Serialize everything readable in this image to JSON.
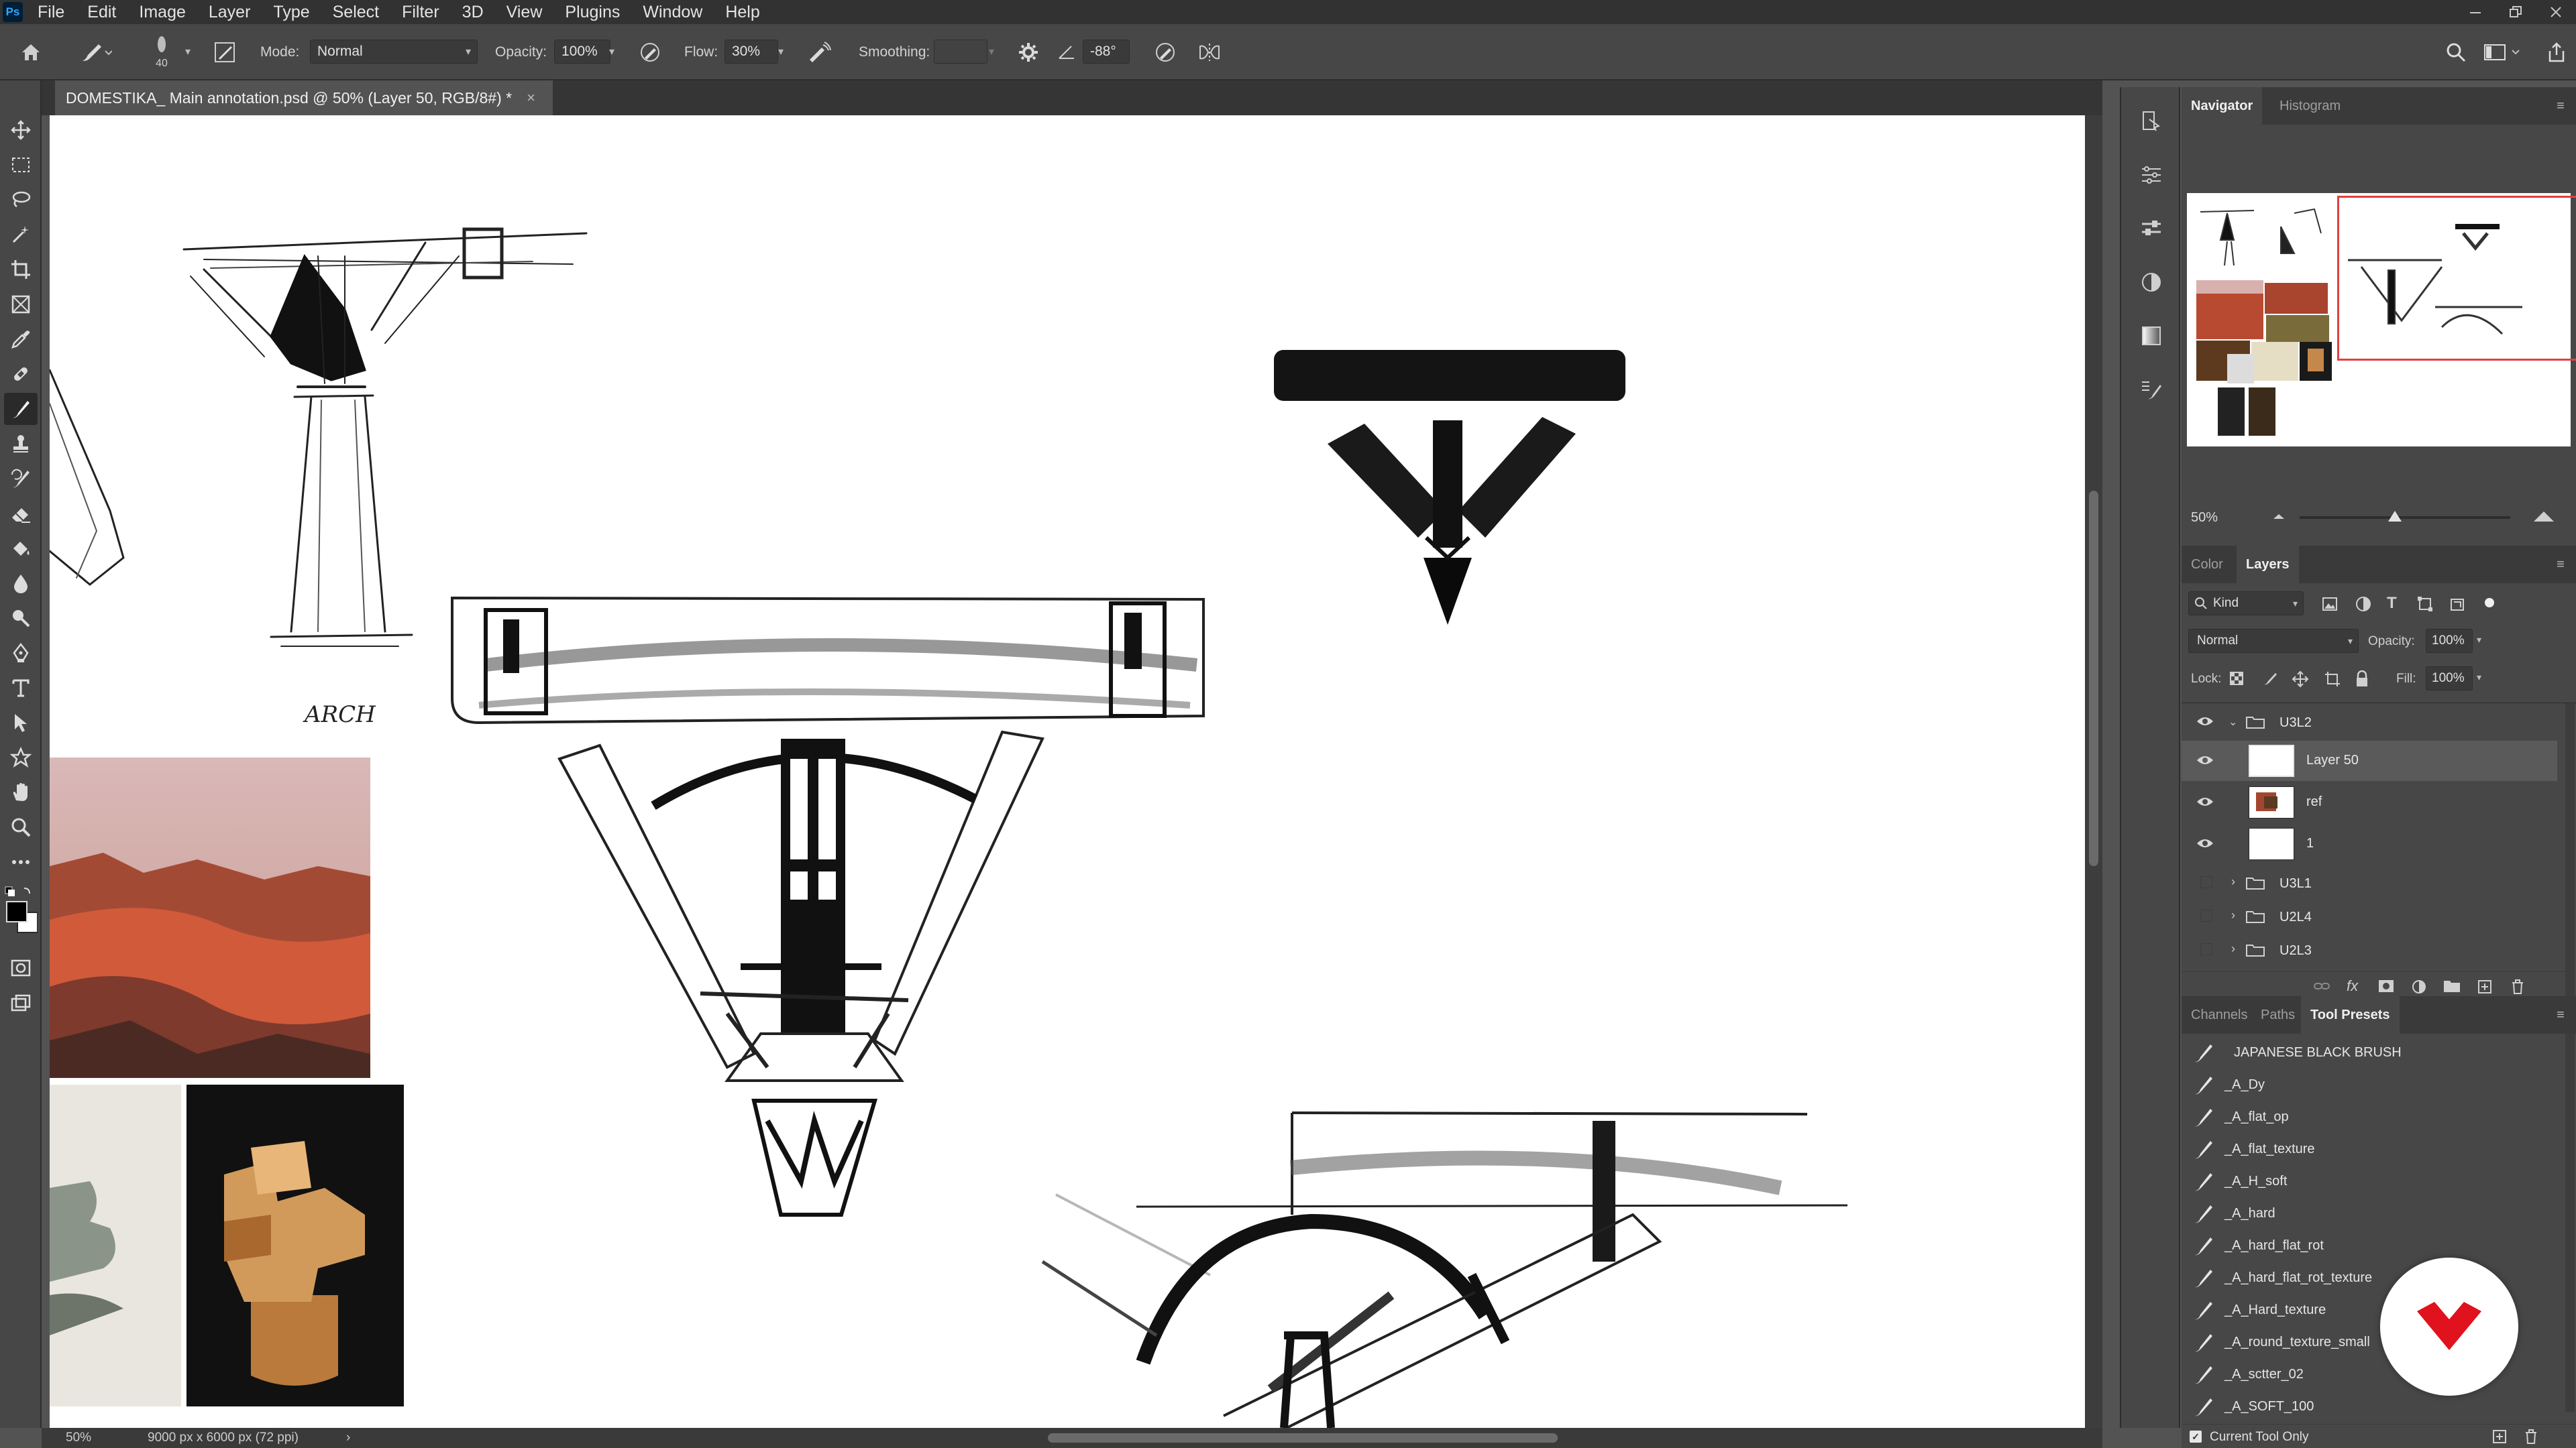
{
  "app": {
    "logo_text": "Ps"
  },
  "menu": [
    "File",
    "Edit",
    "Image",
    "Layer",
    "Type",
    "Select",
    "Filter",
    "3D",
    "View",
    "Plugins",
    "Window",
    "Help"
  ],
  "options_bar": {
    "brush_size": "40",
    "mode_label": "Mode:",
    "mode_value": "Normal",
    "opacity_label": "Opacity:",
    "opacity_value": "100%",
    "flow_label": "Flow:",
    "flow_value": "30%",
    "smoothing_label": "Smoothing:",
    "smoothing_value": "",
    "angle_value": "-88°"
  },
  "document": {
    "tab_title": "DOMESTIKA_ Main annotation.psd @ 50% (Layer 50, RGB/8#) *",
    "close_glyph": "×",
    "canvas_text": "ARCH"
  },
  "status_bar": {
    "zoom": "50%",
    "doc_info": "9000 px x 6000 px (72 ppi)",
    "arrow": "›"
  },
  "navigator": {
    "tabs": [
      "Navigator",
      "Histogram"
    ],
    "active_tab": "Navigator",
    "zoom": "50%"
  },
  "layers_panel": {
    "tabs": [
      "Color",
      "Layers"
    ],
    "active_tab": "Layers",
    "filter_kind": "Kind",
    "blend_mode": "Normal",
    "opacity_label": "Opacity:",
    "opacity_value": "100%",
    "lock_label": "Lock:",
    "fill_label": "Fill:",
    "fill_value": "100%",
    "layers": [
      {
        "name": "U3L2",
        "type": "group",
        "visible": true,
        "expanded": true
      },
      {
        "name": "Layer 50",
        "type": "layer",
        "visible": true,
        "selected": true
      },
      {
        "name": "ref",
        "type": "layer",
        "visible": true
      },
      {
        "name": "1",
        "type": "layer",
        "visible": true
      },
      {
        "name": "U3L1",
        "type": "group",
        "visible": false
      },
      {
        "name": "U2L4",
        "type": "group",
        "visible": false
      },
      {
        "name": "U2L3",
        "type": "group",
        "visible": false
      }
    ],
    "footer_fx": "fx"
  },
  "presets_panel": {
    "tabs": [
      "Channels",
      "Paths",
      "Tool Presets"
    ],
    "active_tab": "Tool Presets",
    "items": [
      "JAPANESE BLACK BRUSH",
      "_A_Dy",
      "_A_flat_op",
      "_A_flat_texture",
      "_A_H_soft",
      "_A_hard",
      "_A_hard_flat_rot",
      "_A_hard_flat_rot_texture",
      "_A_Hard_texture",
      "_A_round_texture_small",
      "_A_sctter_02",
      "_A_SOFT_100"
    ],
    "current_tool_only": "Current Tool Only"
  },
  "colors": {
    "accent": "#e0121d",
    "foreground": "#000000",
    "background": "#ffffff"
  }
}
